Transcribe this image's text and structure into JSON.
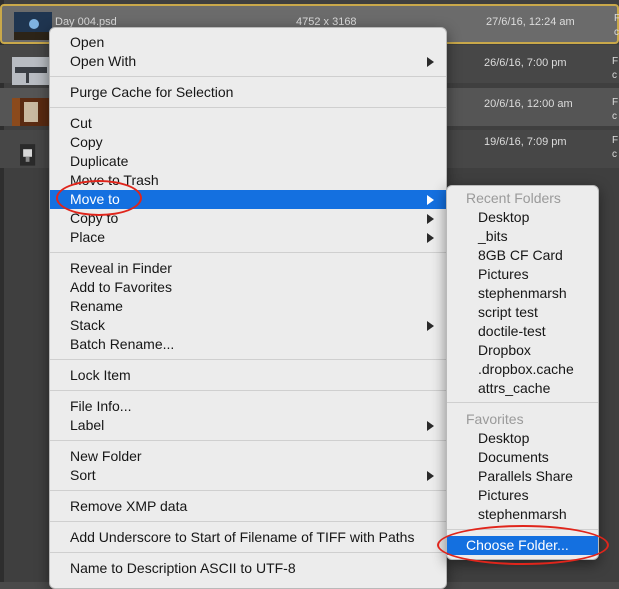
{
  "files": [
    {
      "name": "Day 004.psd",
      "dimensions": "4752 x 3168",
      "date": "27/6/16, 12:24 am",
      "extra": "F\nc"
    },
    {
      "name": "",
      "dimensions": "",
      "date": "26/6/16, 7:00 pm",
      "extra": "F\nc"
    },
    {
      "name": "",
      "dimensions": "",
      "date": "20/6/16, 12:00 am",
      "extra": "F\nc"
    },
    {
      "name": "",
      "dimensions": "",
      "date": "19/6/16, 7:09 pm",
      "extra": "F\nc"
    }
  ],
  "context_menu": {
    "groups": [
      [
        {
          "label": "Open"
        },
        {
          "label": "Open With",
          "submenu": true
        }
      ],
      [
        {
          "label": "Purge Cache for Selection"
        }
      ],
      [
        {
          "label": "Cut"
        },
        {
          "label": "Copy"
        },
        {
          "label": "Duplicate"
        },
        {
          "label": "Move to Trash"
        },
        {
          "label": "Move to",
          "submenu": true,
          "active": true
        },
        {
          "label": "Copy to",
          "submenu": true
        },
        {
          "label": "Place",
          "submenu": true
        }
      ],
      [
        {
          "label": "Reveal in Finder"
        },
        {
          "label": "Add to Favorites"
        },
        {
          "label": "Rename"
        },
        {
          "label": "Stack",
          "submenu": true
        },
        {
          "label": "Batch Rename..."
        }
      ],
      [
        {
          "label": "Lock Item"
        }
      ],
      [
        {
          "label": "File Info..."
        },
        {
          "label": "Label",
          "submenu": true
        }
      ],
      [
        {
          "label": "New Folder"
        },
        {
          "label": "Sort",
          "submenu": true
        }
      ],
      [
        {
          "label": "Remove XMP data"
        }
      ],
      [
        {
          "label": "Add Underscore to Start of Filename of TIFF with Paths"
        }
      ],
      [
        {
          "label": "Name to Description ASCII to UTF-8"
        }
      ]
    ]
  },
  "submenu": {
    "recent_header": "Recent Folders",
    "recent": [
      "Desktop",
      "_bits",
      "8GB CF Card",
      "Pictures",
      "stephenmarsh",
      "script test",
      "doctile-test",
      "Dropbox",
      ".dropbox.cache",
      "attrs_cache"
    ],
    "favorites_header": "Favorites",
    "favorites": [
      "Desktop",
      "Documents",
      "Parallels Share",
      "Pictures",
      "stephenmarsh"
    ],
    "choose_folder": "Choose Folder..."
  },
  "colors": {
    "highlight": "#1470e0",
    "annotation": "#e0251b",
    "menu_bg": "#ececec"
  }
}
